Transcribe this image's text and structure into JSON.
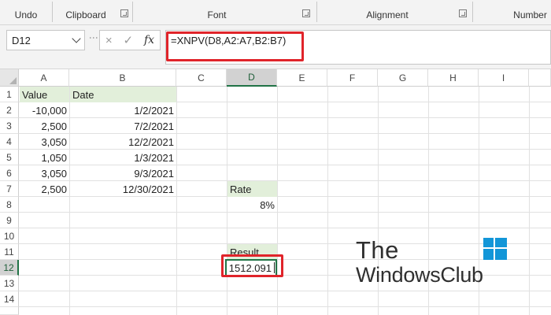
{
  "ribbon": {
    "groups": [
      "Undo",
      "Clipboard",
      "Font",
      "Alignment",
      "Number"
    ]
  },
  "formula_bar": {
    "name_box": "D12",
    "formula": "=XNPV(D8,A2:A7,B2:B7)",
    "cancel_icon": "×",
    "enter_icon": "✓",
    "fx_label": "fx"
  },
  "grid": {
    "columns": [
      "A",
      "B",
      "C",
      "D",
      "E",
      "F",
      "G",
      "H",
      "I"
    ],
    "rows": [
      "1",
      "2",
      "3",
      "4",
      "5",
      "6",
      "7",
      "8",
      "9",
      "10",
      "11",
      "12",
      "13",
      "14"
    ],
    "selected_column": "D",
    "selected_row": "12",
    "headers": {
      "value": "Value",
      "date": "Date"
    },
    "values": [
      "-10,000",
      "2,500",
      "3,050",
      "1,050",
      "3,050",
      "2,500"
    ],
    "dates": [
      "1/2/2021",
      "7/2/2021",
      "12/2/2021",
      "1/3/2021",
      "9/3/2021",
      "12/30/2021"
    ],
    "rate_label": "Rate",
    "rate_value": "8%",
    "result_label": "Result",
    "result_value": "1512.091"
  },
  "watermark": {
    "line1": "The",
    "line2": "WindowsClub"
  },
  "colors": {
    "header_fill": "#e2efda",
    "highlight": "#e0242a",
    "selection": "#217346"
  }
}
